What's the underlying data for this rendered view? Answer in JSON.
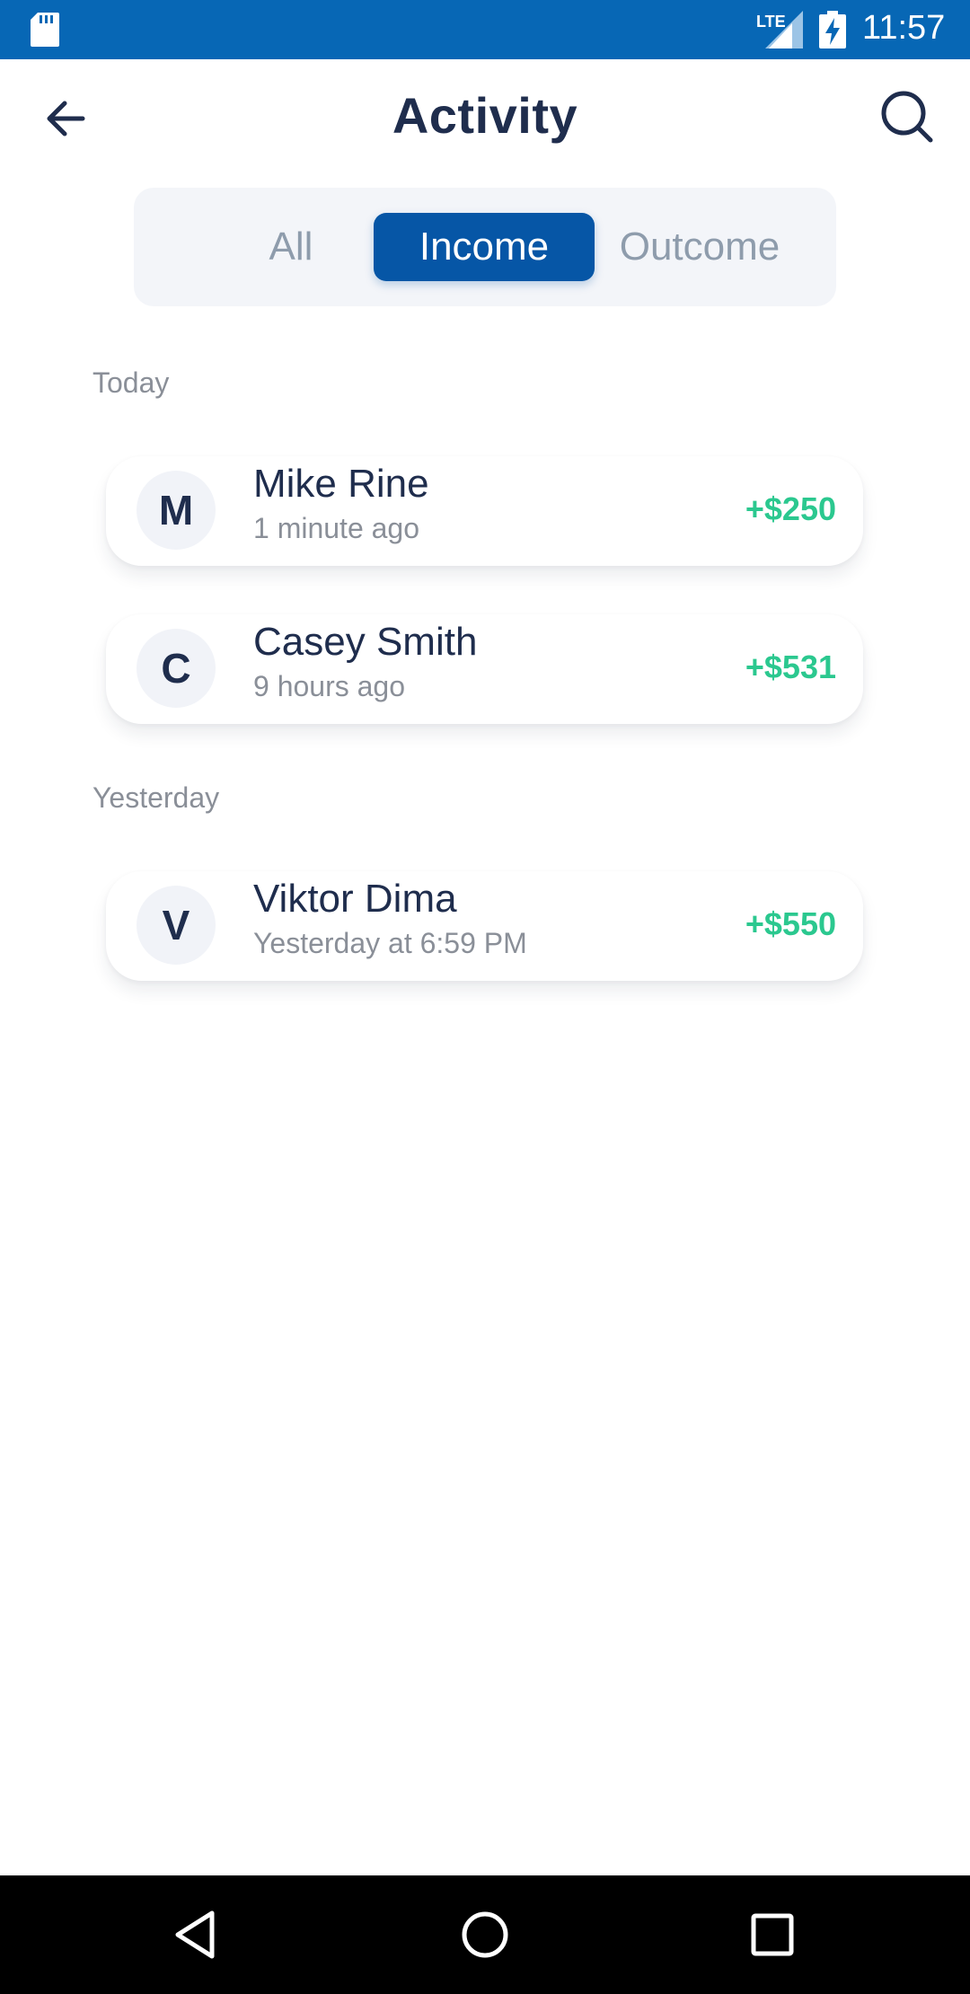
{
  "status_bar": {
    "time": "11:57",
    "network": "LTE",
    "icons": [
      "sd-card-icon",
      "signal-icon",
      "battery-charging-icon"
    ]
  },
  "header": {
    "title": "Activity",
    "back_icon": "arrow-left-icon",
    "search_icon": "search-icon"
  },
  "filter_tabs": {
    "items": [
      {
        "label": "All",
        "selected": false
      },
      {
        "label": "Income",
        "selected": true
      },
      {
        "label": "Outcome",
        "selected": false
      }
    ]
  },
  "sections": [
    {
      "label": "Today",
      "transactions": [
        {
          "initial": "M",
          "name": "Mike Rine",
          "time": "1 minute ago",
          "amount": "+$250"
        },
        {
          "initial": "C",
          "name": "Casey Smith",
          "time": "9 hours ago",
          "amount": "+$531"
        }
      ]
    },
    {
      "label": "Yesterday",
      "transactions": [
        {
          "initial": "V",
          "name": "Viktor Dima",
          "time": "Yesterday at 6:59 PM",
          "amount": "+$550"
        }
      ]
    }
  ],
  "colors": {
    "status_bar": "#0767b5",
    "accent": "#0656a6",
    "title_text": "#1f2d4d",
    "muted_text": "#8a8f98",
    "income_amount": "#2bc88f",
    "segment_bg": "#f3f5f9"
  },
  "nav_bar": {
    "icons": [
      "nav-back-icon",
      "nav-home-icon",
      "nav-recents-icon"
    ]
  }
}
